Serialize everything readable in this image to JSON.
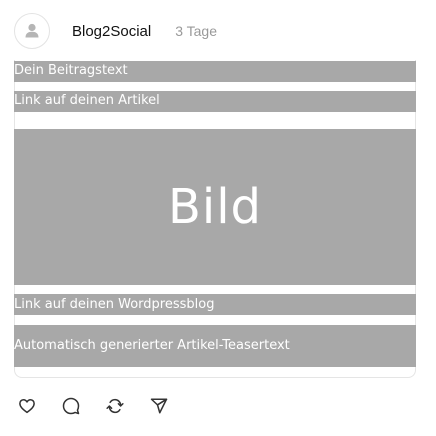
{
  "post": {
    "username": "Blog2Social",
    "time": "3 Tage",
    "post_text": "Dein Beitragstext",
    "article_link": "Link auf deinen Artikel",
    "image_label": "Bild",
    "blog_link": "Link auf deinen Wordpressblog",
    "teaser_text": "Automatisch generierter Artikel-Teasertext"
  },
  "icons": {
    "avatar": "user-avatar-icon",
    "like": "heart-icon",
    "comment": "comment-icon",
    "repost": "repost-icon",
    "share": "send-icon"
  },
  "colors": {
    "placeholder": "#a8a8a8",
    "placeholder_text": "#ffffff",
    "muted": "#999999",
    "icon": "#333333"
  }
}
